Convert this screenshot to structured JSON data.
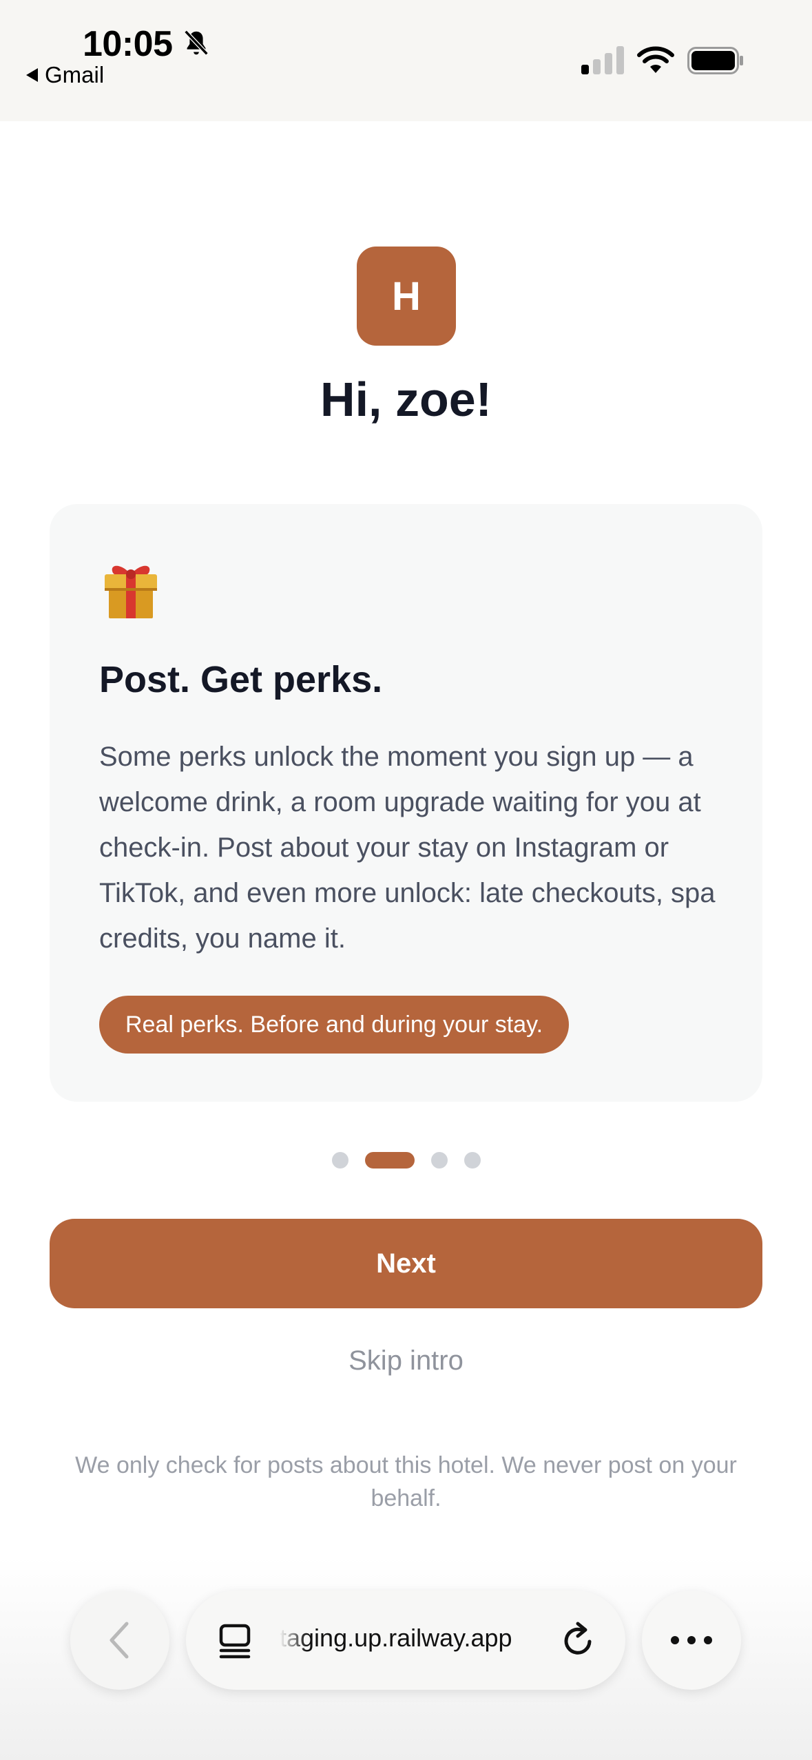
{
  "status_bar": {
    "time": "10:05",
    "back_app": "Gmail"
  },
  "brand": {
    "logo_letter": "H",
    "accent_color": "#b5653c"
  },
  "greeting": "Hi, zoe!",
  "card": {
    "icon": "gift-icon",
    "title": "Post. Get perks.",
    "body": "Some perks unlock the moment you sign up — a welcome drink, a room upgrade waiting for you at check-in. Post about your stay on Instagram or TikTok, and even more unlock: late checkouts, spa credits, you name it.",
    "pill": "Real perks. Before and during your stay."
  },
  "pager": {
    "total": 4,
    "current": 2
  },
  "actions": {
    "next": "Next",
    "skip": "Skip intro"
  },
  "disclaimer": "We only check for posts about this hotel. We never post on your behalf.",
  "browser": {
    "url": "taging.up.railway.app"
  }
}
